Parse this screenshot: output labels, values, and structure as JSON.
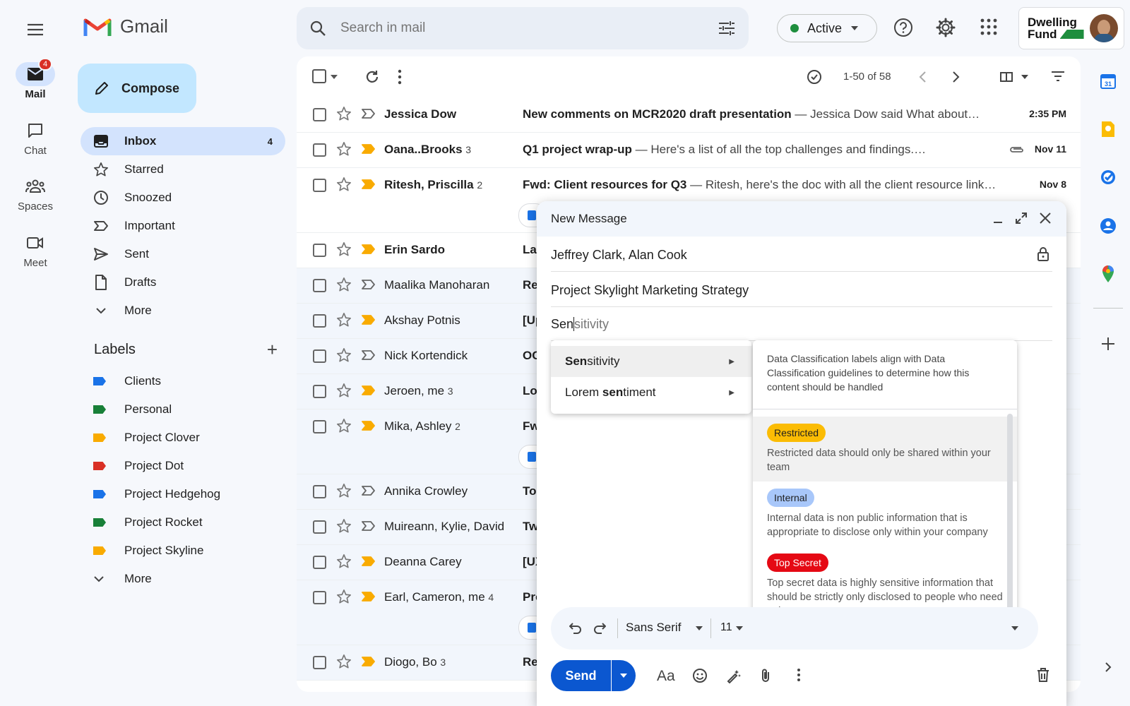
{
  "app": {
    "name": "Gmail"
  },
  "rail": {
    "items": [
      {
        "label": "Mail",
        "badge": "4"
      },
      {
        "label": "Chat"
      },
      {
        "label": "Spaces"
      },
      {
        "label": "Meet"
      }
    ]
  },
  "compose_button": "Compose",
  "nav": {
    "items": [
      {
        "label": "Inbox",
        "count": "4"
      },
      {
        "label": "Starred"
      },
      {
        "label": "Snoozed"
      },
      {
        "label": "Important"
      },
      {
        "label": "Sent"
      },
      {
        "label": "Drafts"
      },
      {
        "label": "More"
      }
    ]
  },
  "labels": {
    "heading": "Labels",
    "items": [
      {
        "label": "Clients",
        "color": "#1a73e8"
      },
      {
        "label": "Personal",
        "color": "#188038"
      },
      {
        "label": "Project Clover",
        "color": "#f9ab00"
      },
      {
        "label": "Project Dot",
        "color": "#d93025"
      },
      {
        "label": "Project Hedgehog",
        "color": "#1a73e8"
      },
      {
        "label": "Project Rocket",
        "color": "#188038"
      },
      {
        "label": "Project Skyline",
        "color": "#f9ab00"
      }
    ],
    "more": "More"
  },
  "search": {
    "placeholder": "Search in mail"
  },
  "status": {
    "label": "Active",
    "color": "#1e8e3e"
  },
  "org": {
    "line1": "Dwelling",
    "line2": "Fund"
  },
  "toolbar": {
    "pagination": "1-50 of 58"
  },
  "emails": [
    {
      "sender": "Jessica Dow",
      "count": "",
      "subject": "New comments on MCR2020 draft presentation",
      "snippet": " — Jessica Dow said What about…",
      "date": "2:35 PM",
      "unread": true,
      "important": false
    },
    {
      "sender": "Oana..Brooks",
      "count": "3",
      "subject": "Q1 project wrap-up",
      "snippet": " — Here's a list of all the top challenges and findings.…",
      "date": "Nov 11",
      "unread": true,
      "important": true
    },
    {
      "sender": "Ritesh, Priscilla",
      "count": "2",
      "subject": "Fwd: Client resources for Q3",
      "snippet": " — Ritesh, here's the doc with all the client resource link…",
      "date": "Nov 8",
      "unread": true,
      "important": true
    },
    {
      "sender": "Erin Sardo",
      "count": "",
      "subject": "La",
      "snippet": "",
      "date": "",
      "unread": true,
      "important": true
    },
    {
      "sender": "Maalika Manoharan",
      "count": "",
      "subject": "Re",
      "snippet": "",
      "date": "",
      "unread": false,
      "important": false
    },
    {
      "sender": "Akshay Potnis",
      "count": "",
      "subject": "[Up",
      "snippet": "",
      "date": "",
      "unread": false,
      "important": true
    },
    {
      "sender": "Nick Kortendick",
      "count": "",
      "subject": "OC",
      "snippet": "",
      "date": "",
      "unread": false,
      "important": false
    },
    {
      "sender": "Jeroen, me",
      "count": "3",
      "subject": "Lo",
      "snippet": "",
      "date": "",
      "unread": false,
      "important": true
    },
    {
      "sender": "Mika, Ashley",
      "count": "2",
      "subject": "Fw",
      "snippet": "",
      "date": "",
      "unread": false,
      "important": true
    },
    {
      "sender": "Annika Crowley",
      "count": "",
      "subject": "To",
      "snippet": "",
      "date": "",
      "unread": false,
      "important": false
    },
    {
      "sender": "Muireann, Kylie, David",
      "count": "",
      "subject": "Tw",
      "snippet": "",
      "date": "",
      "unread": false,
      "important": false
    },
    {
      "sender": "Deanna Carey",
      "count": "",
      "subject": "[UX",
      "snippet": "",
      "date": "",
      "unread": false,
      "important": true
    },
    {
      "sender": "Earl, Cameron, me",
      "count": "4",
      "subject": "Pro",
      "snippet": "",
      "date": "",
      "unread": false,
      "important": true
    },
    {
      "sender": "Diogo, Bo",
      "count": "3",
      "subject": "Re",
      "snippet": "",
      "date": "",
      "unread": false,
      "important": true
    }
  ],
  "compose": {
    "title": "New Message",
    "to": "Jeffrey Clark, Alan Cook",
    "subject": "Project Skylight Marketing Strategy",
    "typed": "Sen",
    "ghost": "sitivity",
    "suggestions": [
      {
        "pre": "Sen",
        "post": "sitivity",
        "lead": ""
      },
      {
        "pre": "sen",
        "post": "timent",
        "lead": "Lorem "
      }
    ],
    "description": "Data Classification labels align with Data Classification guidelines to determine how this content should be handled",
    "options": [
      {
        "chip": "Restricted",
        "chip_color": "#fbbc04",
        "chip_text": "#1f1f1f",
        "text": "Restricted data should only be shared within your team"
      },
      {
        "chip": "Internal",
        "chip_color": "#a8c7fa",
        "chip_text": "#1f1f1f",
        "text": "Internal data is non public information that is appropriate to disclose only within your company"
      },
      {
        "chip": "Top Secret",
        "chip_color": "#e50914",
        "chip_text": "#ffffff",
        "text": "Top secret data is highly sensitive information that should be strictly only disclosed to people who need to know"
      }
    ],
    "font": "Sans Serif",
    "size": "11",
    "send": "Send"
  },
  "colors": {
    "accent": "#0b57d0",
    "important": "#f9ab00"
  }
}
